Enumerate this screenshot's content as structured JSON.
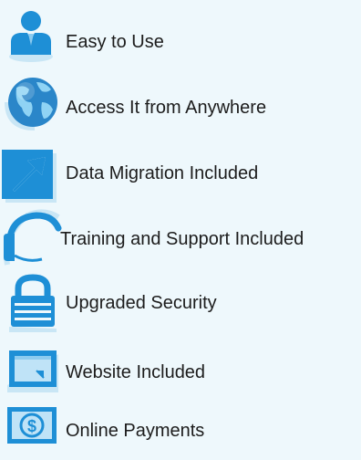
{
  "features": [
    {
      "icon": "person-icon",
      "label": "Easy to Use"
    },
    {
      "icon": "globe-icon",
      "label": "Access It from Anywhere"
    },
    {
      "icon": "arrow-icon",
      "label": "Data Migration Included"
    },
    {
      "icon": "headset-icon",
      "label": "Training and Support Included"
    },
    {
      "icon": "lock-icon",
      "label": "Upgraded Security"
    },
    {
      "icon": "browser-window-icon",
      "label": "Website Included"
    },
    {
      "icon": "dollar-icon",
      "label": "Online Payments"
    }
  ],
  "colors": {
    "background": "#eef8fc",
    "icon_blue": "#1e8fd6",
    "icon_light": "#8ccbef",
    "icon_shadow": "#c9e6f5",
    "text": "#1c1c1c"
  }
}
